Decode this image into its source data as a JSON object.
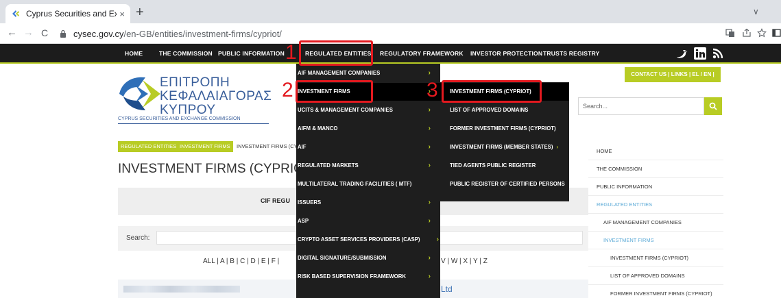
{
  "browser": {
    "tab_title": "Cyprus Securities and Exchang",
    "tab_close": "×",
    "new_tab": "+",
    "url_host": "cysec.gov.cy",
    "url_path": "/en-GB/entities/investment-firms/cypriot/",
    "back": "←",
    "forward": "→",
    "reload": "C",
    "chevron": "∨"
  },
  "site_nav": {
    "items": [
      "HOME",
      "THE COMMISSION",
      "PUBLIC INFORMATION",
      "REGULATED ENTITIES",
      "REGULATORY FRAMEWORK",
      "INVESTOR PROTECTION",
      "TRUSTS REGISTRY"
    ]
  },
  "logo": {
    "line1": "ΕΠΙΤΡΟΠΗ",
    "line2": "ΚΕΦΑΛΑΙΑΓΟΡΑΣ",
    "line3": "ΚΥΠΡΟΥ",
    "sub": "CYPRUS SECURITIES AND EXCHANGE COMMISSION"
  },
  "header": {
    "contact": "CONTACT US | LINKS | EL / EN |",
    "search_placeholder": "Search..."
  },
  "breadcrumb": [
    "REGULATED ENTITIES",
    "INVESTMENT FIRMS",
    "INVESTMENT FIRMS (CY"
  ],
  "main": {
    "title": "INVESTMENT FIRMS (CYPRIOT)",
    "cif_label": "CIF REGU",
    "search_label": "Search:",
    "alpha_left": "ALL | A | B | C | D | E | F |",
    "alpha_right": "V | W | X | Y | Z",
    "row_suffix": "Ltd"
  },
  "sidebar": {
    "items": [
      {
        "label": "HOME",
        "indent": 0,
        "active": false
      },
      {
        "label": "THE COMMISSION",
        "indent": 0,
        "active": false
      },
      {
        "label": "PUBLIC INFORMATION",
        "indent": 0,
        "active": false
      },
      {
        "label": "REGULATED ENTITIES",
        "indent": 0,
        "active": true
      },
      {
        "label": "AIF MANAGEMENT COMPANIES",
        "indent": 1,
        "active": false
      },
      {
        "label": "INVESTMENT FIRMS",
        "indent": 1,
        "active": true
      },
      {
        "label": "INVESTMENT FIRMS (CYPRIOT)",
        "indent": 2,
        "active": false
      },
      {
        "label": "LIST OF APPROVED DOMAINS",
        "indent": 2,
        "active": false
      },
      {
        "label": "FORMER INVESTMENT FIRMS (CYPRIOT)",
        "indent": 2,
        "active": false
      }
    ]
  },
  "dropdown_regulated": {
    "items": [
      {
        "label": "AIF MANAGEMENT COMPANIES",
        "arrow": true
      },
      {
        "label": "INVESTMENT FIRMS",
        "arrow": true
      },
      {
        "label": "UCITS & MANAGEMENT COMPANIES",
        "arrow": true
      },
      {
        "label": "AIFM & MANCO",
        "arrow": true
      },
      {
        "label": "AIF",
        "arrow": true
      },
      {
        "label": "REGULATED MARKETS",
        "arrow": true
      },
      {
        "label": "MULTILATERAL TRADING FACILITIES ( MTF)",
        "arrow": false
      },
      {
        "label": "ISSUERS",
        "arrow": true
      },
      {
        "label": "ASP",
        "arrow": true
      },
      {
        "label": "CRYPTO ASSET SERVICES PROVIDERS (CASP)",
        "arrow": true
      },
      {
        "label": "DIGITAL SIGNATURE/SUBMISSION",
        "arrow": true
      },
      {
        "label": "RISK BASED SUPERVISION FRAMEWORK",
        "arrow": true
      }
    ]
  },
  "dropdown_investment": {
    "items": [
      {
        "label": "INVESTMENT FIRMS (CYPRIOT)",
        "arrow": false
      },
      {
        "label": "LIST OF APPROVED DOMAINS",
        "arrow": false
      },
      {
        "label": "FORMER INVESTMENT FIRMS (CYPRIOT)",
        "arrow": false
      },
      {
        "label": "INVESTMENT FIRMS (MEMBER STATES)",
        "arrow": true
      },
      {
        "label": "TIED AGENTS PUBLIC REGISTER",
        "arrow": false
      },
      {
        "label": "PUBLIC REGISTER OF CERTIFIED PERSONS",
        "arrow": false
      }
    ]
  },
  "annotations": [
    "1",
    "2",
    "3"
  ],
  "colors": {
    "accent_green": "#b8cc24",
    "annotation_red": "#e3191f",
    "nav_dark": "#1c1c1c",
    "logo_blue": "#3a5f9b",
    "active_blue": "#5aa9d6"
  },
  "icons": [
    "favicon-icon",
    "lock-icon",
    "translate-icon",
    "share-icon",
    "star-icon",
    "sidebar-icon",
    "twitter-icon",
    "linkedin-icon",
    "rss-icon",
    "search-icon"
  ]
}
